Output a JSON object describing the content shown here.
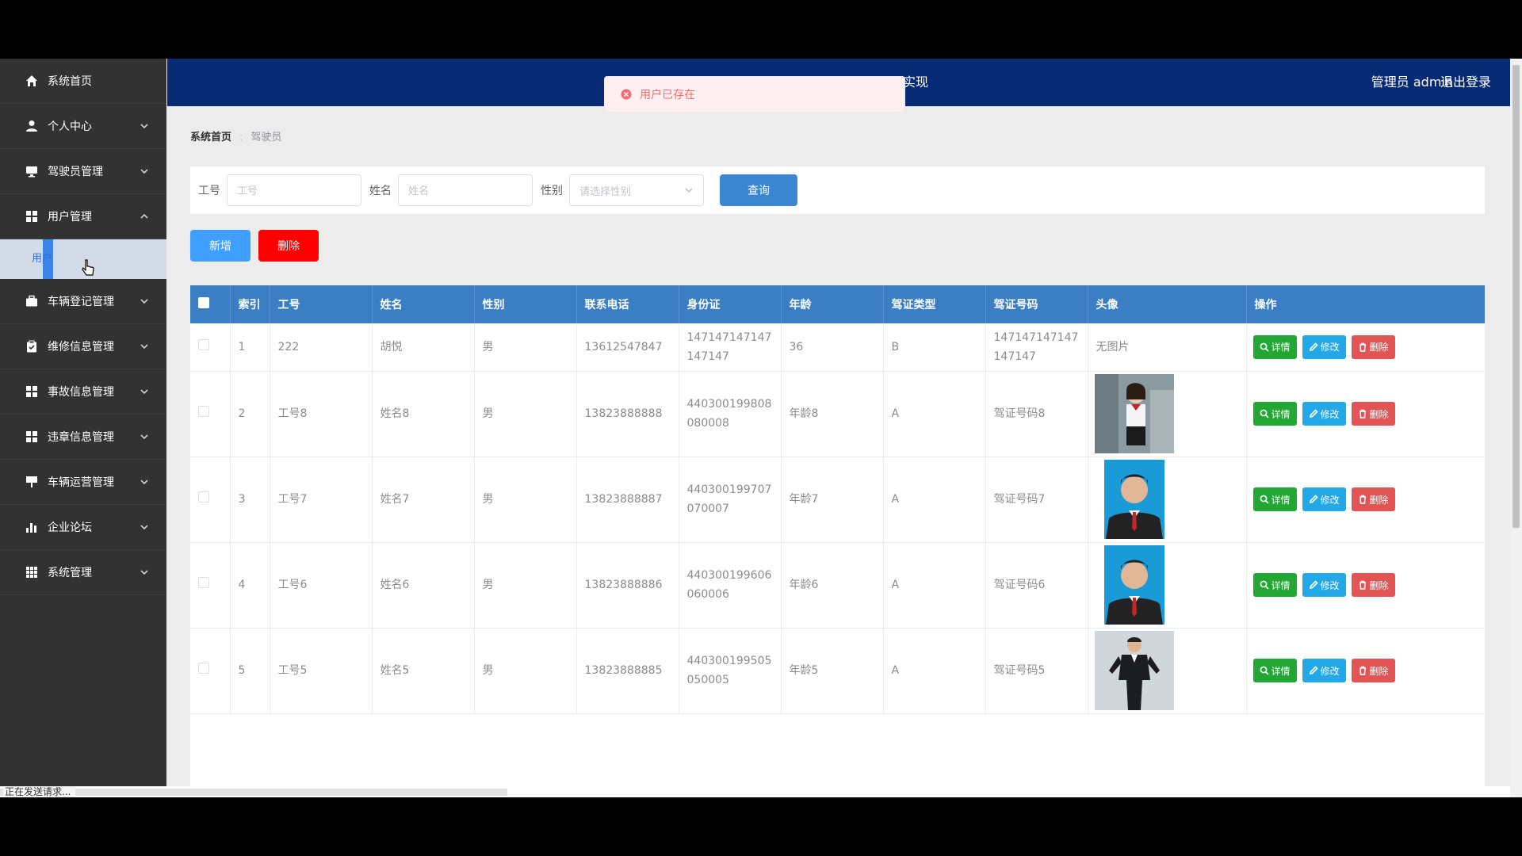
{
  "sidebar": {
    "items": [
      {
        "label": "系统首页",
        "icon": "home-icon",
        "chevron": ""
      },
      {
        "label": "个人中心",
        "icon": "user-icon",
        "chevron": "down"
      },
      {
        "label": "驾驶员管理",
        "icon": "monitor-icon",
        "chevron": "down"
      },
      {
        "label": "用户管理",
        "icon": "grid-icon",
        "chevron": "up"
      },
      {
        "label": "车辆登记管理",
        "icon": "briefcase-icon",
        "chevron": "down"
      },
      {
        "label": "维修信息管理",
        "icon": "clipboard-icon",
        "chevron": "down"
      },
      {
        "label": "事故信息管理",
        "icon": "grid-icon",
        "chevron": "down"
      },
      {
        "label": "违章信息管理",
        "icon": "grid-icon",
        "chevron": "down"
      },
      {
        "label": "车辆运营管理",
        "icon": "presentation-icon",
        "chevron": "down"
      },
      {
        "label": "企业论坛",
        "icon": "bar-chart-icon",
        "chevron": "down"
      },
      {
        "label": "系统管理",
        "icon": "apps-icon",
        "chevron": "down"
      }
    ],
    "submenu_label": "用户"
  },
  "topbar": {
    "title_fragment": "实现",
    "admin_label": "管理员 admin",
    "logout_label": "退出登录"
  },
  "toast": {
    "message": "用户已存在",
    "color": "#f56c6c"
  },
  "breadcrumb": {
    "home": "系统首页",
    "current": "驾驶员"
  },
  "search": {
    "job_label": "工号",
    "job_placeholder": "工号",
    "name_label": "姓名",
    "name_placeholder": "姓名",
    "gender_label": "性别",
    "gender_placeholder": "请选择性别",
    "query_label": "查询"
  },
  "actions": {
    "add_label": "新增",
    "delete_label": "删除"
  },
  "table": {
    "headers": [
      "索引",
      "工号",
      "姓名",
      "性别",
      "联系电话",
      "身份证",
      "年龄",
      "驾证类型",
      "驾证号码",
      "头像",
      "操作"
    ],
    "op_labels": {
      "detail": "详情",
      "edit": "修改",
      "delete": "删除"
    },
    "no_image_text": "无图片",
    "rows": [
      {
        "index": "1",
        "job": "222",
        "name": "胡悦",
        "gender": "男",
        "phone": "13612547847",
        "id_card": "147147147147147147",
        "age": "36",
        "license_type": "B",
        "license_no": "147147147147147147",
        "avatar": "none"
      },
      {
        "index": "2",
        "job": "工号8",
        "name": "姓名8",
        "gender": "男",
        "phone": "13823888888",
        "id_card": "440300199808080008",
        "age": "年龄8",
        "license_type": "A",
        "license_no": "驾证号码8",
        "avatar": "woman-photo"
      },
      {
        "index": "3",
        "job": "工号7",
        "name": "姓名7",
        "gender": "男",
        "phone": "13823888887",
        "id_card": "440300199707070007",
        "age": "年龄7",
        "license_type": "A",
        "license_no": "驾证号码7",
        "avatar": "man-id-photo"
      },
      {
        "index": "4",
        "job": "工号6",
        "name": "姓名6",
        "gender": "男",
        "phone": "13823888886",
        "id_card": "440300199606060006",
        "age": "年龄6",
        "license_type": "A",
        "license_no": "驾证号码6",
        "avatar": "man-id-photo"
      },
      {
        "index": "5",
        "job": "工号5",
        "name": "姓名5",
        "gender": "男",
        "phone": "13823888885",
        "id_card": "440300199505050005",
        "age": "年龄5",
        "license_type": "A",
        "license_no": "驾证号码5",
        "avatar": "man-suit-photo"
      }
    ]
  },
  "status_bar": {
    "text": "正在发送请求..."
  },
  "colors": {
    "topbar": "#072a74",
    "sidebar": "#323232",
    "table_header": "#3b7ec4",
    "accent": "#409eff",
    "danger": "#ff0000"
  }
}
